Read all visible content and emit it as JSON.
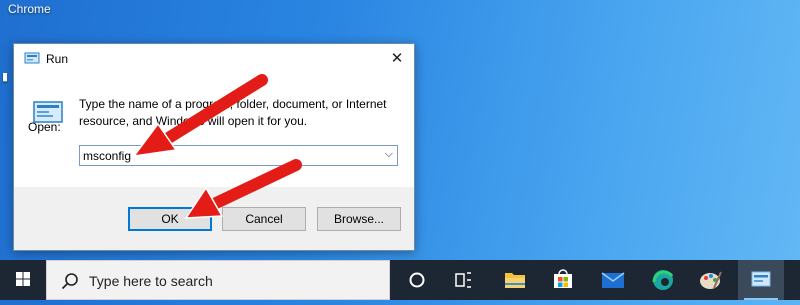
{
  "desktop": {
    "chrome_label": "Chrome"
  },
  "run_dialog": {
    "title": "Run",
    "description": "Type the name of a program, folder, document, or Internet resource, and Windows will open it for you.",
    "open_label": "Open:",
    "open_value": "msconfig",
    "buttons": {
      "ok": "OK",
      "cancel": "Cancel",
      "browse": "Browse..."
    }
  },
  "taskbar": {
    "search_placeholder": "Type here to search",
    "icons": [
      "windows-start-icon",
      "cortana-icon",
      "task-view-icon",
      "file-explorer-icon",
      "microsoft-store-icon",
      "mail-icon",
      "edge-icon",
      "paint-icon",
      "run-icon"
    ]
  },
  "colors": {
    "arrow": "#e41c17",
    "accent": "#0078d7",
    "taskbar": "#1c2733"
  }
}
